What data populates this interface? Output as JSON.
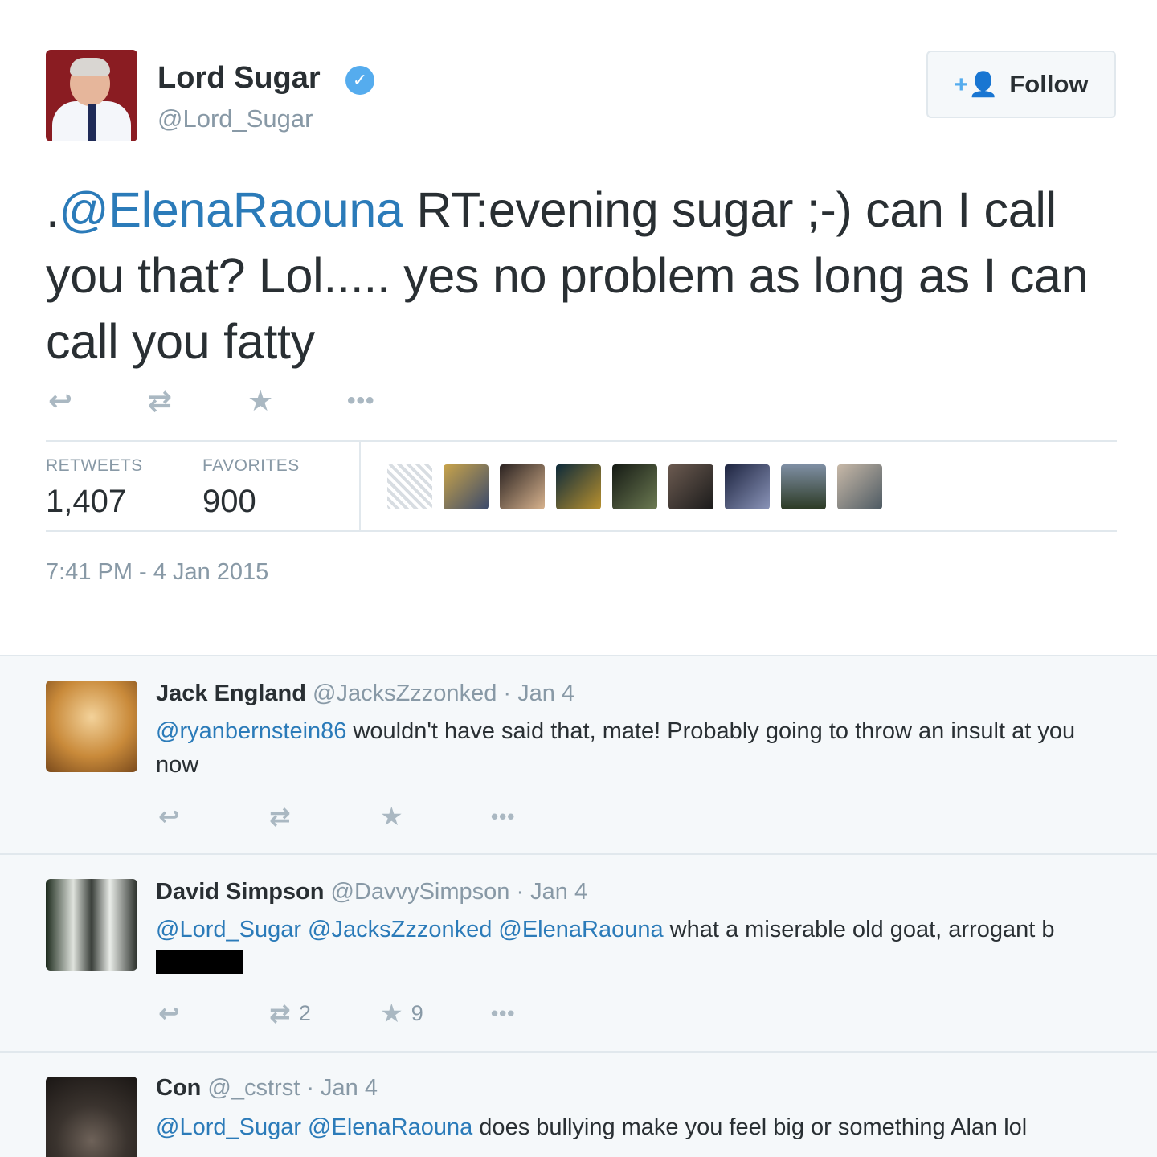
{
  "main_tweet": {
    "name": "Lord Sugar",
    "handle": "@Lord_Sugar",
    "follow_label": "Follow",
    "text_prefix": ".",
    "text_mention": "@ElenaRaouna",
    "text_body": " RT:evening sugar ;-) can I call you that? Lol..... yes no problem as long as I can call you fatty",
    "retweets_label": "RETWEETS",
    "retweets_value": "1,407",
    "favorites_label": "FAVORITES",
    "favorites_value": "900",
    "timestamp": "7:41 PM - 4 Jan 2015"
  },
  "replies": [
    {
      "name": "Jack England",
      "meta": " @JacksZzzonked · Jan 4",
      "mentions": "@ryanbernstein86",
      "text": " wouldn't have said that, mate! Probably going to throw an insult at you now",
      "retweet_count": "",
      "favorite_count": ""
    },
    {
      "name": "David Simpson",
      "meta": " @DavvySimpson · Jan 4",
      "mentions": "@Lord_Sugar @JacksZzzonked @ElenaRaouna",
      "text": " what a miserable old goat, arrogant b",
      "retweet_count": "2",
      "favorite_count": "9"
    },
    {
      "name": "Con",
      "meta": " @_cstrst · Jan 4",
      "mentions": "@Lord_Sugar @ElenaRaouna",
      "text": " does bullying make you feel big or something Alan lol",
      "retweet_count": "",
      "favorite_count": ""
    }
  ],
  "icons": {
    "reply": "reply-icon",
    "retweet": "retweet-icon",
    "favorite": "star-icon",
    "more": "more-icon",
    "verified": "verified-badge-icon",
    "follow": "add-user-icon"
  },
  "colors": {
    "link": "#2b7bb9",
    "accent": "#55acee",
    "muted": "#8899a6",
    "action": "#aab8c2"
  }
}
